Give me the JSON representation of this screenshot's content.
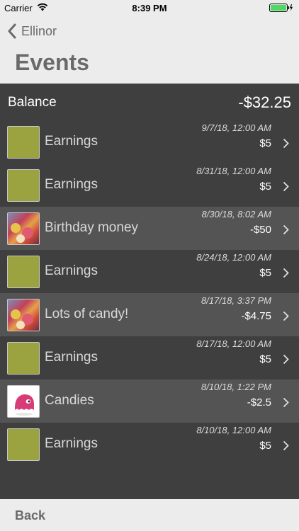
{
  "status_bar": {
    "carrier": "Carrier",
    "time": "8:39 PM",
    "wifi_icon": "wifi-icon",
    "battery_icon": "battery-icon"
  },
  "nav": {
    "back_label": "Ellinor",
    "title": "Events"
  },
  "balance": {
    "label": "Balance",
    "value": "-$32.25"
  },
  "events": [
    {
      "title": "Earnings",
      "date": "9/7/18, 12:00 AM",
      "amount": "$5",
      "thumb": "swatch"
    },
    {
      "title": "Earnings",
      "date": "8/31/18, 12:00 AM",
      "amount": "$5",
      "thumb": "swatch"
    },
    {
      "title": "Birthday money",
      "date": "8/30/18, 8:02 AM",
      "amount": "-$50",
      "thumb": "candy-photo"
    },
    {
      "title": "Earnings",
      "date": "8/24/18, 12:00 AM",
      "amount": "$5",
      "thumb": "swatch"
    },
    {
      "title": "Lots of candy!",
      "date": "8/17/18, 3:37 PM",
      "amount": "-$4.75",
      "thumb": "candy-photo"
    },
    {
      "title": "Earnings",
      "date": "8/17/18, 12:00 AM",
      "amount": "$5",
      "thumb": "swatch"
    },
    {
      "title": "Candies",
      "date": "8/10/18, 1:22 PM",
      "amount": "-$2.5",
      "thumb": "monster"
    },
    {
      "title": "Earnings",
      "date": "8/10/18, 12:00 AM",
      "amount": "$5",
      "thumb": "swatch"
    }
  ],
  "toolbar": {
    "back_label": "Back"
  },
  "colors": {
    "nav_background": "#ececec",
    "content_background": "#3f3f3f",
    "highlight_row": "#545454",
    "swatch": "#9ba240",
    "battery_fill": "#4cd964"
  }
}
